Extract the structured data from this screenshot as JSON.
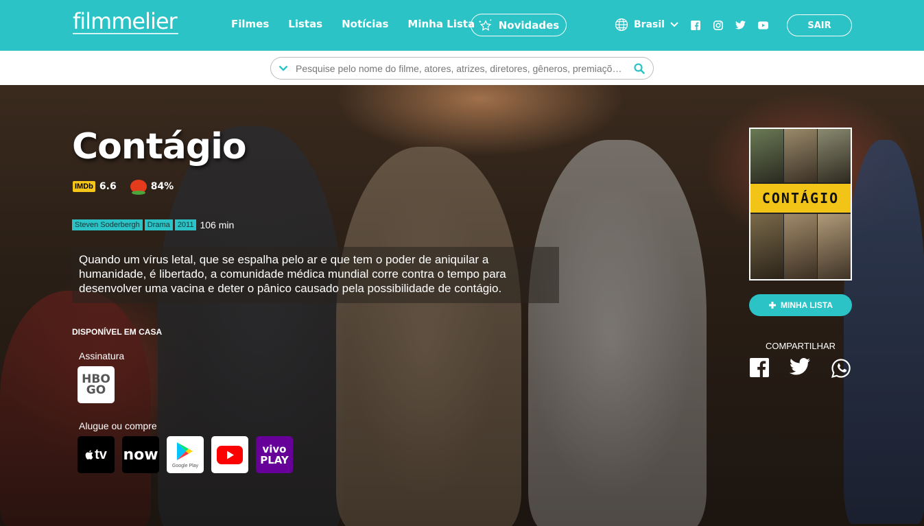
{
  "header": {
    "logo": "filmmelier",
    "nav": [
      "Filmes",
      "Listas",
      "Notícias",
      "Minha Lista"
    ],
    "novidades": "Novidades",
    "country": "Brasil",
    "logout": "SAIR",
    "socials": [
      "facebook-icon",
      "instagram-icon",
      "twitter-icon",
      "youtube-icon"
    ]
  },
  "search": {
    "placeholder": "Pesquise pelo nome do filme, atores, atrizes, diretores, gêneros, premiações..."
  },
  "movie": {
    "title": "Contágio",
    "imdb_label": "IMDb",
    "imdb_score": "6.6",
    "rt_score": "84%",
    "tags": [
      "Steven Soderbergh",
      "Drama",
      "2011"
    ],
    "runtime": "106 min",
    "synopsis": "Quando um vírus letal, que se espalha pelo ar e que tem o poder de aniquilar a humanidade, é libertado, a comunidade médica mundial corre contra o tempo para desenvolver uma vacina e deter o pânico causado pela possibilidade de contágio.",
    "poster_title": "CONTÁGIO"
  },
  "availability": {
    "heading": "DISPONÍVEL EM CASA",
    "subscription_label": "Assinatura",
    "subscription": [
      {
        "name": "HBO GO",
        "line1": "HBO",
        "line2": "GO"
      }
    ],
    "rent_label": "Alugue ou compre",
    "rent": [
      {
        "name": "Apple TV",
        "label": "tv"
      },
      {
        "name": "NOW",
        "label": "now"
      },
      {
        "name": "Google Play",
        "label": "Google Play"
      },
      {
        "name": "YouTube",
        "label": ""
      },
      {
        "name": "Vivo Play",
        "line1": "vivo",
        "line2": "PLAY"
      }
    ]
  },
  "sidebar": {
    "add_list": "MINHA LISTA",
    "share_label": "COMPARTILHAR",
    "share": [
      "facebook-icon",
      "twitter-icon",
      "whatsapp-icon"
    ]
  },
  "colors": {
    "accent": "#2bc3c6",
    "imdb": "#f5c518",
    "poster_band": "#f2c418"
  }
}
